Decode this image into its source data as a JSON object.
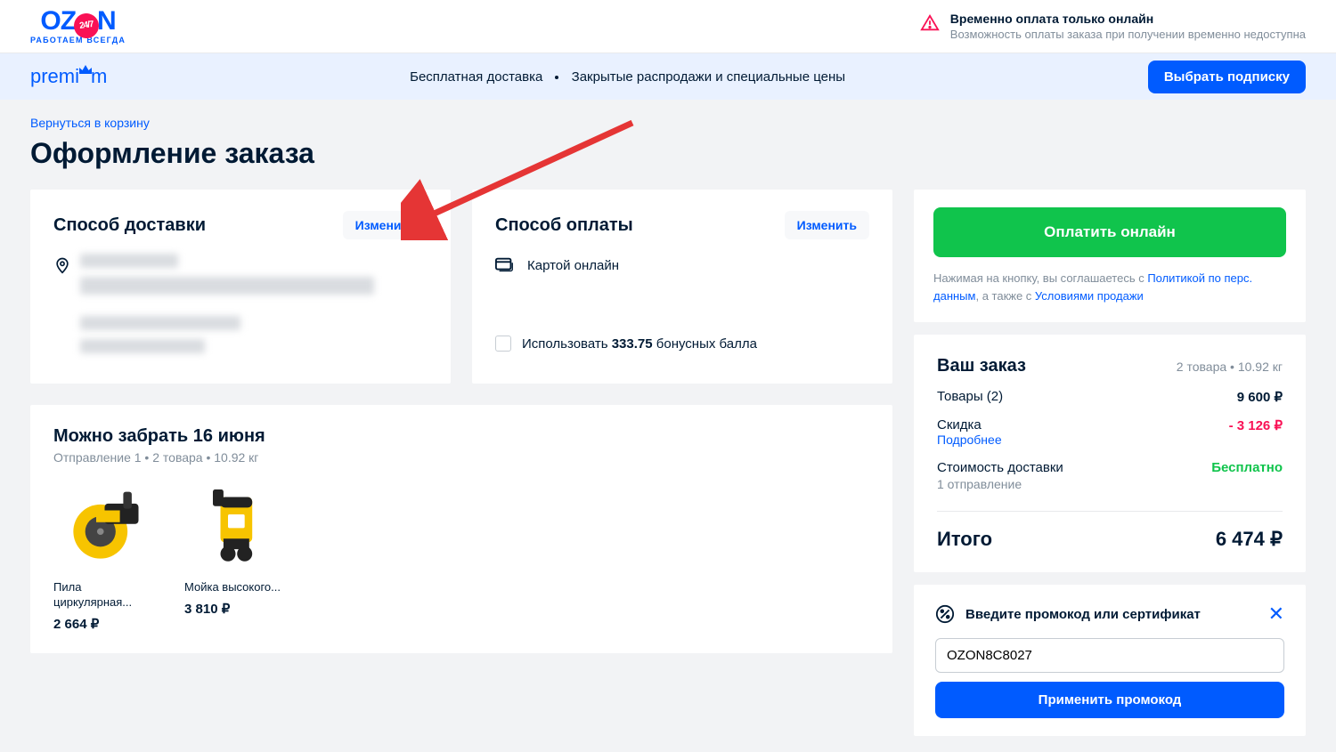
{
  "header": {
    "logo_text_1": "OZ",
    "logo_text_2": "N",
    "logo_badge": "24/7",
    "logo_sub": "РАБОТАЕМ ВСЕГДА",
    "notice_title": "Временно оплата только онлайн",
    "notice_sub": "Возможность оплаты заказа при получении временно недоступна"
  },
  "premium": {
    "logo": "premiUm",
    "benefit1": "Бесплатная доставка",
    "benefit2": "Закрытые распродажи и специальные цены",
    "cta": "Выбрать подписку"
  },
  "page": {
    "back": "Вернуться в корзину",
    "title": "Оформление заказа"
  },
  "delivery": {
    "title": "Способ доставки",
    "change": "Изменить"
  },
  "payment": {
    "title": "Способ оплаты",
    "change": "Изменить",
    "method": "Картой онлайн",
    "bonus_prefix": "Использовать ",
    "bonus_value": "333.75",
    "bonus_suffix": " бонусных балла"
  },
  "pickup": {
    "title": "Можно забрать 16 июня",
    "sub": "Отправление 1 • 2 товара • 10.92 кг",
    "products": [
      {
        "name": "Пила циркулярная...",
        "price": "2 664 ₽"
      },
      {
        "name": "Мойка высокого...",
        "price": "3 810 ₽"
      }
    ]
  },
  "side": {
    "pay": "Оплатить онлайн",
    "agree_1": "Нажимая на кнопку, вы соглашаетесь с ",
    "agree_link1": "Политикой по перс. данным",
    "agree_2": ", а также с ",
    "agree_link2": "Условиями продажи"
  },
  "summary": {
    "title": "Ваш заказ",
    "meta": "2 товара • 10.92 кг",
    "items_label": "Товары (2)",
    "items_value": "9 600 ₽",
    "discount_label": "Скидка",
    "discount_value": "- 3 126 ₽",
    "more": "Подробнее",
    "ship_label": "Стоимость доставки",
    "ship_sub": "1 отправление",
    "ship_value": "Бесплатно",
    "total_label": "Итого",
    "total_value": "6 474 ₽"
  },
  "promo": {
    "title": "Введите промокод или сертификат",
    "value": "OZON8C8027",
    "apply": "Применить промокод"
  }
}
